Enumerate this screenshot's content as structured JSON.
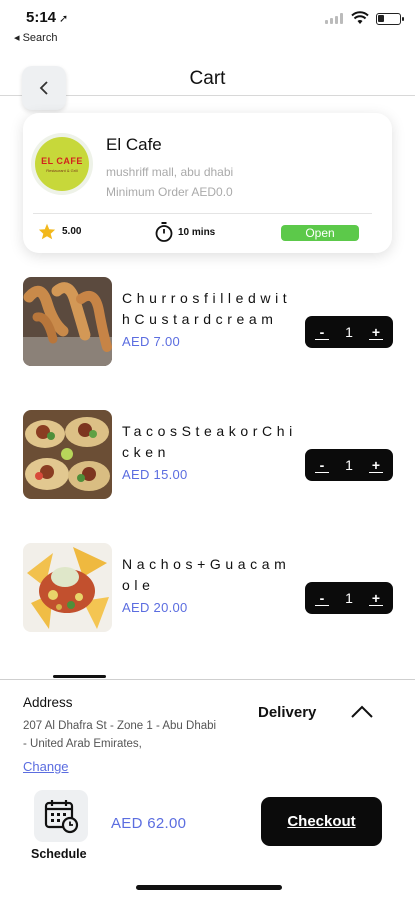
{
  "status_bar": {
    "time": "5:14",
    "location_arrow": "➚",
    "back_app": "◂ Search"
  },
  "header": {
    "title": "Cart",
    "back_icon": "chevron-left-icon"
  },
  "restaurant": {
    "name": "El Cafe",
    "logo_text": "EL CAFE",
    "logo_subtext": "Restaurant & Grill",
    "address": "mushriff mall, abu dhabi",
    "minimum_order": "Minimum Order AED0.0",
    "rating": "5.00",
    "delivery_time": "10 mins",
    "status": "Open"
  },
  "cart": {
    "items": [
      {
        "name": "ChurrosfilledwithCustardcream",
        "price": "AED 7.00",
        "quantity": "1",
        "minus": "-",
        "plus": "+"
      },
      {
        "name": "TacosSteakorChicken",
        "price": "AED 15.00",
        "quantity": "1",
        "minus": "-",
        "plus": "+"
      },
      {
        "name": "Nachos+Guacamole",
        "price": "AED 20.00",
        "quantity": "1",
        "minus": "-",
        "plus": "+"
      }
    ]
  },
  "footer": {
    "address_label": "Address",
    "address_text": "207 Al Dhafra St - Zone 1 - Abu Dhabi - United Arab Emirates,",
    "change_label": "Change",
    "mode_label": "Delivery",
    "schedule_label": "Schedule",
    "total": "AED 62.00",
    "checkout_label": "Checkout"
  },
  "colors": {
    "accent_price": "#5b6de0",
    "open_badge": "#5cc94a",
    "button_dark": "#0b0b0b"
  }
}
